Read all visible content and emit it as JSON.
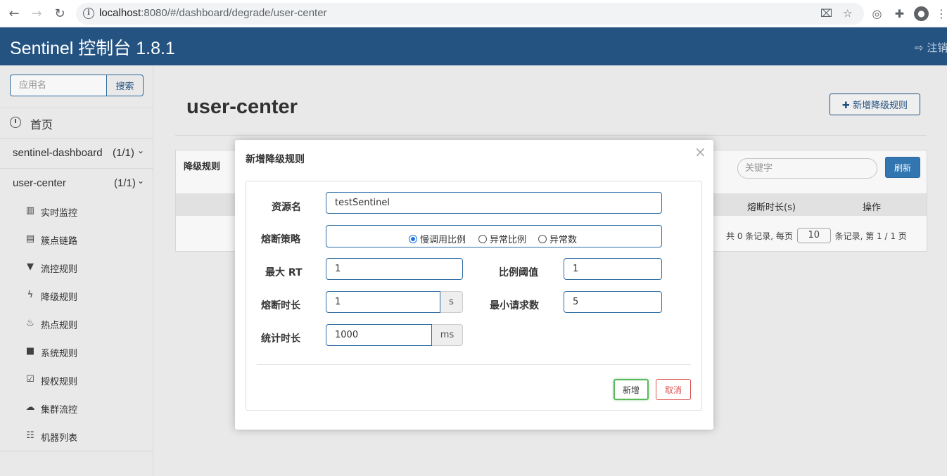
{
  "browser": {
    "url_host": "localhost",
    "url_path": ":8080/#/dashboard/degrade/user-center"
  },
  "header": {
    "title": "Sentinel 控制台 1.8.1",
    "logout": "注销"
  },
  "sidebar": {
    "search_placeholder": "应用名",
    "search_button": "搜索",
    "home": "首页",
    "apps": [
      {
        "name": "sentinel-dashboard",
        "count": "(1/1)"
      },
      {
        "name": "user-center",
        "count": "(1/1)"
      }
    ],
    "menu": [
      {
        "label": "实时监控",
        "icon": "bar-chart-icon"
      },
      {
        "label": "簇点链路",
        "icon": "list-icon"
      },
      {
        "label": "流控规则",
        "icon": "filter-icon"
      },
      {
        "label": "降级规则",
        "icon": "flash-icon"
      },
      {
        "label": "热点规则",
        "icon": "fire-icon"
      },
      {
        "label": "系统规则",
        "icon": "lock-icon"
      },
      {
        "label": "授权规则",
        "icon": "check-icon"
      },
      {
        "label": "集群流控",
        "icon": "cloud-icon"
      },
      {
        "label": "机器列表",
        "icon": "th-list-icon"
      }
    ]
  },
  "main": {
    "title": "user-center",
    "add_button": "新增降级规则",
    "panel_title": "降级规则",
    "keyword_placeholder": "关键字",
    "refresh_button": "刷新",
    "columns": {
      "duration": "熔断时长(s)",
      "action": "操作"
    },
    "pager": {
      "prefix": "共 0 条记录, 每页",
      "page_size": "10",
      "suffix": "条记录, 第 1 / 1 页"
    }
  },
  "modal": {
    "title": "新增降级规则",
    "close": "×",
    "resource_label": "资源名",
    "resource_value": "testSentinel",
    "strategy_label": "熔断策略",
    "strategies": [
      "慢调用比例",
      "异常比例",
      "异常数"
    ],
    "selected_strategy": "慢调用比例",
    "max_rt_label": "最大 RT",
    "max_rt_value": "1",
    "ratio_label": "比例阈值",
    "ratio_value": "1",
    "duration_label": "熔断时长",
    "duration_value": "1",
    "duration_unit": "s",
    "min_request_label": "最小请求数",
    "min_request_value": "5",
    "stat_label": "统计时长",
    "stat_value": "1000",
    "stat_unit": "ms",
    "add_button": "新增",
    "cancel_button": "取消"
  },
  "colors": {
    "header_bg": "#245382",
    "primary": "#337ab7",
    "success_border": "#5cb85c",
    "danger": "#d9534f"
  }
}
